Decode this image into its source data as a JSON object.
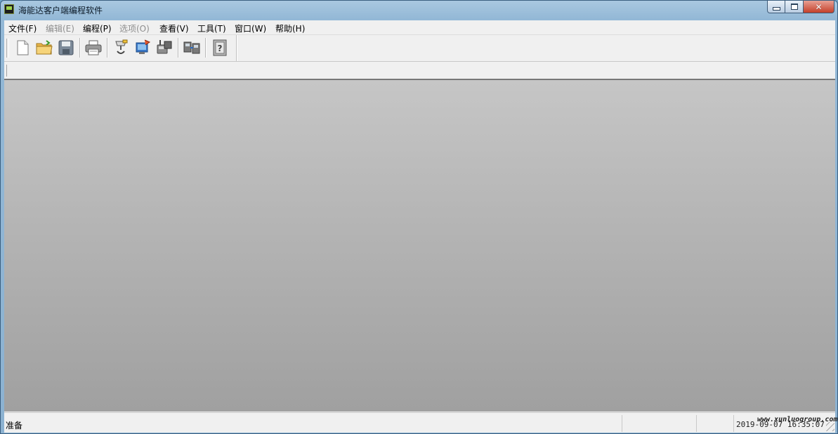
{
  "window": {
    "title": "海能达客户端编程软件"
  },
  "menu": {
    "items": [
      {
        "label": "文件(F)",
        "enabled": true
      },
      {
        "label": "编辑(E)",
        "enabled": false
      },
      {
        "label": "编程(P)",
        "enabled": true
      },
      {
        "label": "选项(O)",
        "enabled": false
      },
      {
        "label": "查看(V)",
        "enabled": true
      },
      {
        "label": "工具(T)",
        "enabled": true
      },
      {
        "label": "窗口(W)",
        "enabled": true
      },
      {
        "label": "帮助(H)",
        "enabled": true
      }
    ]
  },
  "toolbar": {
    "buttons": [
      {
        "icon": "new-file-icon"
      },
      {
        "icon": "open-folder-icon"
      },
      {
        "icon": "save-icon"
      },
      {
        "icon": "print-icon"
      },
      {
        "icon": "read-radio-icon"
      },
      {
        "icon": "write-radio-icon"
      },
      {
        "icon": "radio-device-icon"
      },
      {
        "icon": "clone-radio-icon"
      },
      {
        "icon": "help-icon"
      }
    ]
  },
  "status": {
    "text": "准备",
    "datetime": "2019-09-07 16:35:07",
    "watermark": "www.xunluogroup.com"
  },
  "colors": {
    "title_bar": "#a9c8e0",
    "client_bg": "#f0f0f0",
    "mdi_top": "#c6c6c6",
    "mdi_bottom": "#a0a0a0",
    "close_button": "#c4402a"
  }
}
